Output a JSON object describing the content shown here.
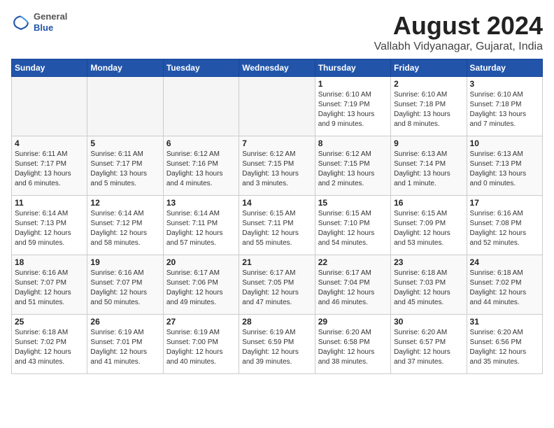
{
  "header": {
    "logo_general": "General",
    "logo_blue": "Blue",
    "month_title": "August 2024",
    "location": "Vallabh Vidyanagar, Gujarat, India"
  },
  "weekdays": [
    "Sunday",
    "Monday",
    "Tuesday",
    "Wednesday",
    "Thursday",
    "Friday",
    "Saturday"
  ],
  "weeks": [
    [
      {
        "day": "",
        "info": ""
      },
      {
        "day": "",
        "info": ""
      },
      {
        "day": "",
        "info": ""
      },
      {
        "day": "",
        "info": ""
      },
      {
        "day": "1",
        "info": "Sunrise: 6:10 AM\nSunset: 7:19 PM\nDaylight: 13 hours\nand 9 minutes."
      },
      {
        "day": "2",
        "info": "Sunrise: 6:10 AM\nSunset: 7:18 PM\nDaylight: 13 hours\nand 8 minutes."
      },
      {
        "day": "3",
        "info": "Sunrise: 6:10 AM\nSunset: 7:18 PM\nDaylight: 13 hours\nand 7 minutes."
      }
    ],
    [
      {
        "day": "4",
        "info": "Sunrise: 6:11 AM\nSunset: 7:17 PM\nDaylight: 13 hours\nand 6 minutes."
      },
      {
        "day": "5",
        "info": "Sunrise: 6:11 AM\nSunset: 7:17 PM\nDaylight: 13 hours\nand 5 minutes."
      },
      {
        "day": "6",
        "info": "Sunrise: 6:12 AM\nSunset: 7:16 PM\nDaylight: 13 hours\nand 4 minutes."
      },
      {
        "day": "7",
        "info": "Sunrise: 6:12 AM\nSunset: 7:15 PM\nDaylight: 13 hours\nand 3 minutes."
      },
      {
        "day": "8",
        "info": "Sunrise: 6:12 AM\nSunset: 7:15 PM\nDaylight: 13 hours\nand 2 minutes."
      },
      {
        "day": "9",
        "info": "Sunrise: 6:13 AM\nSunset: 7:14 PM\nDaylight: 13 hours\nand 1 minute."
      },
      {
        "day": "10",
        "info": "Sunrise: 6:13 AM\nSunset: 7:13 PM\nDaylight: 13 hours\nand 0 minutes."
      }
    ],
    [
      {
        "day": "11",
        "info": "Sunrise: 6:14 AM\nSunset: 7:13 PM\nDaylight: 12 hours\nand 59 minutes."
      },
      {
        "day": "12",
        "info": "Sunrise: 6:14 AM\nSunset: 7:12 PM\nDaylight: 12 hours\nand 58 minutes."
      },
      {
        "day": "13",
        "info": "Sunrise: 6:14 AM\nSunset: 7:11 PM\nDaylight: 12 hours\nand 57 minutes."
      },
      {
        "day": "14",
        "info": "Sunrise: 6:15 AM\nSunset: 7:11 PM\nDaylight: 12 hours\nand 55 minutes."
      },
      {
        "day": "15",
        "info": "Sunrise: 6:15 AM\nSunset: 7:10 PM\nDaylight: 12 hours\nand 54 minutes."
      },
      {
        "day": "16",
        "info": "Sunrise: 6:15 AM\nSunset: 7:09 PM\nDaylight: 12 hours\nand 53 minutes."
      },
      {
        "day": "17",
        "info": "Sunrise: 6:16 AM\nSunset: 7:08 PM\nDaylight: 12 hours\nand 52 minutes."
      }
    ],
    [
      {
        "day": "18",
        "info": "Sunrise: 6:16 AM\nSunset: 7:07 PM\nDaylight: 12 hours\nand 51 minutes."
      },
      {
        "day": "19",
        "info": "Sunrise: 6:16 AM\nSunset: 7:07 PM\nDaylight: 12 hours\nand 50 minutes."
      },
      {
        "day": "20",
        "info": "Sunrise: 6:17 AM\nSunset: 7:06 PM\nDaylight: 12 hours\nand 49 minutes."
      },
      {
        "day": "21",
        "info": "Sunrise: 6:17 AM\nSunset: 7:05 PM\nDaylight: 12 hours\nand 47 minutes."
      },
      {
        "day": "22",
        "info": "Sunrise: 6:17 AM\nSunset: 7:04 PM\nDaylight: 12 hours\nand 46 minutes."
      },
      {
        "day": "23",
        "info": "Sunrise: 6:18 AM\nSunset: 7:03 PM\nDaylight: 12 hours\nand 45 minutes."
      },
      {
        "day": "24",
        "info": "Sunrise: 6:18 AM\nSunset: 7:02 PM\nDaylight: 12 hours\nand 44 minutes."
      }
    ],
    [
      {
        "day": "25",
        "info": "Sunrise: 6:18 AM\nSunset: 7:02 PM\nDaylight: 12 hours\nand 43 minutes."
      },
      {
        "day": "26",
        "info": "Sunrise: 6:19 AM\nSunset: 7:01 PM\nDaylight: 12 hours\nand 41 minutes."
      },
      {
        "day": "27",
        "info": "Sunrise: 6:19 AM\nSunset: 7:00 PM\nDaylight: 12 hours\nand 40 minutes."
      },
      {
        "day": "28",
        "info": "Sunrise: 6:19 AM\nSunset: 6:59 PM\nDaylight: 12 hours\nand 39 minutes."
      },
      {
        "day": "29",
        "info": "Sunrise: 6:20 AM\nSunset: 6:58 PM\nDaylight: 12 hours\nand 38 minutes."
      },
      {
        "day": "30",
        "info": "Sunrise: 6:20 AM\nSunset: 6:57 PM\nDaylight: 12 hours\nand 37 minutes."
      },
      {
        "day": "31",
        "info": "Sunrise: 6:20 AM\nSunset: 6:56 PM\nDaylight: 12 hours\nand 35 minutes."
      }
    ]
  ]
}
